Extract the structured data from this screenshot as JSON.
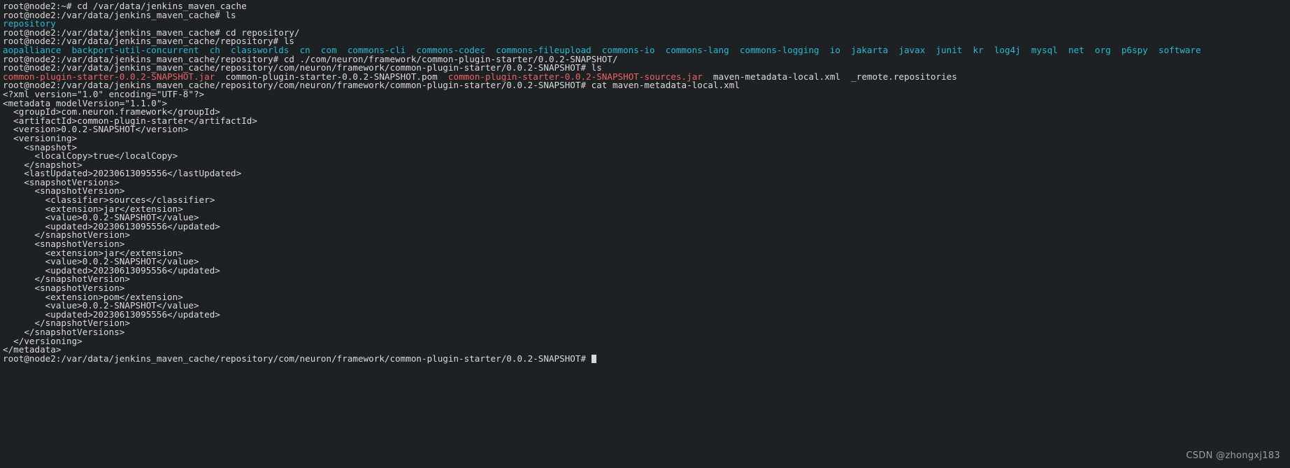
{
  "terminal": {
    "title": "root@node2 terminal",
    "colors": {
      "background": "#1e2124",
      "foreground": "#d9dbdb",
      "directory": "#27b9d4",
      "archive": "#ef6262",
      "cursor": "#d9dbdb",
      "watermark": "#9aa0a6"
    },
    "watermark": "CSDN @zhongxj183",
    "lines": [
      {
        "id": "l01",
        "segments": [
          {
            "text": "root@node2:~# cd /var/data/jenkins_maven_cache",
            "color": "default"
          }
        ]
      },
      {
        "id": "l02",
        "segments": [
          {
            "text": "root@node2:/var/data/jenkins_maven_cache# ls",
            "color": "default"
          }
        ]
      },
      {
        "id": "l03",
        "segments": [
          {
            "text": "repository",
            "color": "directory"
          }
        ]
      },
      {
        "id": "l04",
        "segments": [
          {
            "text": "root@node2:/var/data/jenkins_maven_cache# cd repository/",
            "color": "default"
          }
        ]
      },
      {
        "id": "l05",
        "segments": [
          {
            "text": "root@node2:/var/data/jenkins_maven_cache/repository# ls",
            "color": "default"
          }
        ]
      },
      {
        "id": "l06",
        "segments": [
          {
            "text": "aopalliance  backport-util-concurrent  ch  classworlds  cn  com  commons-cli  commons-codec  commons-fileupload  commons-io  commons-lang  commons-logging  io  jakarta  javax  junit  kr  log4j  mysql  net  org  p6spy  software",
            "color": "directory"
          }
        ]
      },
      {
        "id": "l07",
        "segments": [
          {
            "text": "root@node2:/var/data/jenkins_maven_cache/repository# cd ./com/neuron/framework/common-plugin-starter/0.0.2-SNAPSHOT/",
            "color": "default"
          }
        ]
      },
      {
        "id": "l08",
        "segments": [
          {
            "text": "root@node2:/var/data/jenkins_maven_cache/repository/com/neuron/framework/common-plugin-starter/0.0.2-SNAPSHOT# ls",
            "color": "default"
          }
        ]
      },
      {
        "id": "l09",
        "segments": [
          {
            "text": "common-plugin-starter-0.0.2-SNAPSHOT.jar",
            "color": "archive"
          },
          {
            "text": "  common-plugin-starter-0.0.2-SNAPSHOT.pom  ",
            "color": "default"
          },
          {
            "text": "common-plugin-starter-0.0.2-SNAPSHOT-sources.jar",
            "color": "archive"
          },
          {
            "text": "  maven-metadata-local.xml  _remote.repositories",
            "color": "default"
          }
        ]
      },
      {
        "id": "l10",
        "segments": [
          {
            "text": "root@node2:/var/data/jenkins_maven_cache/repository/com/neuron/framework/common-plugin-starter/0.0.2-SNAPSHOT# cat maven-metadata-local.xml",
            "color": "default"
          }
        ]
      },
      {
        "id": "l11",
        "segments": [
          {
            "text": "<?xml version=\"1.0\" encoding=\"UTF-8\"?>",
            "color": "default"
          }
        ]
      },
      {
        "id": "l12",
        "segments": [
          {
            "text": "<metadata modelVersion=\"1.1.0\">",
            "color": "default"
          }
        ]
      },
      {
        "id": "l13",
        "segments": [
          {
            "text": "  <groupId>com.neuron.framework</groupId>",
            "color": "default"
          }
        ]
      },
      {
        "id": "l14",
        "segments": [
          {
            "text": "  <artifactId>common-plugin-starter</artifactId>",
            "color": "default"
          }
        ]
      },
      {
        "id": "l15",
        "segments": [
          {
            "text": "  <version>0.0.2-SNAPSHOT</version>",
            "color": "default"
          }
        ]
      },
      {
        "id": "l16",
        "segments": [
          {
            "text": "  <versioning>",
            "color": "default"
          }
        ]
      },
      {
        "id": "l17",
        "segments": [
          {
            "text": "    <snapshot>",
            "color": "default"
          }
        ]
      },
      {
        "id": "l18",
        "segments": [
          {
            "text": "      <localCopy>true</localCopy>",
            "color": "default"
          }
        ]
      },
      {
        "id": "l19",
        "segments": [
          {
            "text": "    </snapshot>",
            "color": "default"
          }
        ]
      },
      {
        "id": "l20",
        "segments": [
          {
            "text": "    <lastUpdated>20230613095556</lastUpdated>",
            "color": "default"
          }
        ]
      },
      {
        "id": "l21",
        "segments": [
          {
            "text": "    <snapshotVersions>",
            "color": "default"
          }
        ]
      },
      {
        "id": "l22",
        "segments": [
          {
            "text": "      <snapshotVersion>",
            "color": "default"
          }
        ]
      },
      {
        "id": "l23",
        "segments": [
          {
            "text": "        <classifier>sources</classifier>",
            "color": "default"
          }
        ]
      },
      {
        "id": "l24",
        "segments": [
          {
            "text": "        <extension>jar</extension>",
            "color": "default"
          }
        ]
      },
      {
        "id": "l25",
        "segments": [
          {
            "text": "        <value>0.0.2-SNAPSHOT</value>",
            "color": "default"
          }
        ]
      },
      {
        "id": "l26",
        "segments": [
          {
            "text": "        <updated>20230613095556</updated>",
            "color": "default"
          }
        ]
      },
      {
        "id": "l27",
        "segments": [
          {
            "text": "      </snapshotVersion>",
            "color": "default"
          }
        ]
      },
      {
        "id": "l28",
        "segments": [
          {
            "text": "      <snapshotVersion>",
            "color": "default"
          }
        ]
      },
      {
        "id": "l29",
        "segments": [
          {
            "text": "        <extension>jar</extension>",
            "color": "default"
          }
        ]
      },
      {
        "id": "l30",
        "segments": [
          {
            "text": "        <value>0.0.2-SNAPSHOT</value>",
            "color": "default"
          }
        ]
      },
      {
        "id": "l31",
        "segments": [
          {
            "text": "        <updated>20230613095556</updated>",
            "color": "default"
          }
        ]
      },
      {
        "id": "l32",
        "segments": [
          {
            "text": "      </snapshotVersion>",
            "color": "default"
          }
        ]
      },
      {
        "id": "l33",
        "segments": [
          {
            "text": "      <snapshotVersion>",
            "color": "default"
          }
        ]
      },
      {
        "id": "l34",
        "segments": [
          {
            "text": "        <extension>pom</extension>",
            "color": "default"
          }
        ]
      },
      {
        "id": "l35",
        "segments": [
          {
            "text": "        <value>0.0.2-SNAPSHOT</value>",
            "color": "default"
          }
        ]
      },
      {
        "id": "l36",
        "segments": [
          {
            "text": "        <updated>20230613095556</updated>",
            "color": "default"
          }
        ]
      },
      {
        "id": "l37",
        "segments": [
          {
            "text": "      </snapshotVersion>",
            "color": "default"
          }
        ]
      },
      {
        "id": "l38",
        "segments": [
          {
            "text": "    </snapshotVersions>",
            "color": "default"
          }
        ]
      },
      {
        "id": "l39",
        "segments": [
          {
            "text": "  </versioning>",
            "color": "default"
          }
        ]
      },
      {
        "id": "l40",
        "segments": [
          {
            "text": "</metadata>",
            "color": "default"
          }
        ]
      },
      {
        "id": "l41",
        "prompt": true,
        "segments": [
          {
            "text": "root@node2:/var/data/jenkins_maven_cache/repository/com/neuron/framework/common-plugin-starter/0.0.2-SNAPSHOT# ",
            "color": "default"
          }
        ]
      }
    ]
  }
}
